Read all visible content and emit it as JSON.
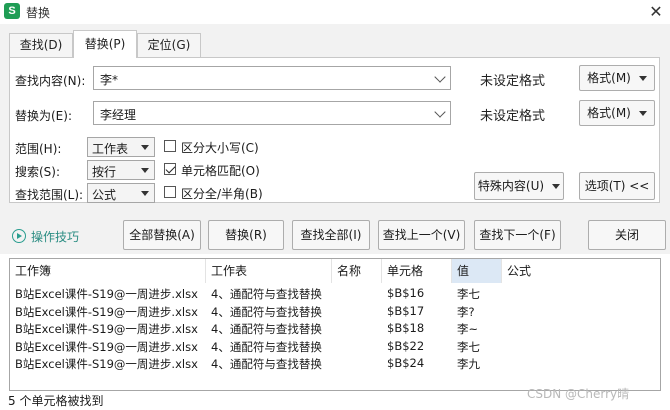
{
  "window": {
    "title": "替换",
    "app_icon_letter": "S"
  },
  "tabs": [
    {
      "label": "查找(D)"
    },
    {
      "label": "替换(P)"
    },
    {
      "label": "定位(G)"
    }
  ],
  "find": {
    "label": "查找内容(N):",
    "value": "李*",
    "format_status": "未设定格式",
    "format_button": "格式(M)"
  },
  "replace": {
    "label": "替换为(E):",
    "value": "李经理",
    "format_status": "未设定格式",
    "format_button": "格式(M)"
  },
  "options": {
    "scope": {
      "label": "范围(H):",
      "value": "工作表"
    },
    "search": {
      "label": "搜索(S):",
      "value": "按行"
    },
    "lookin": {
      "label": "查找范围(L):",
      "value": "公式"
    },
    "match_case": {
      "label": "区分大小写(C)",
      "checked": false
    },
    "match_cell": {
      "label": "单元格匹配(O)",
      "checked": true
    },
    "full_half": {
      "label": "区分全/半角(B)",
      "checked": false
    }
  },
  "special_button": "特殊内容(U)",
  "options_button": "选项(T) <<",
  "tips_link": "操作技巧",
  "actions": {
    "replace_all": "全部替换(A)",
    "replace": "替换(R)",
    "find_all": "查找全部(I)",
    "find_prev": "查找上一个(V)",
    "find_next": "查找下一个(F)",
    "close": "关闭"
  },
  "results": {
    "columns": [
      "工作簿",
      "工作表",
      "名称",
      "单元格",
      "值",
      "公式"
    ],
    "rows": [
      {
        "book": "B站Excel课件-S19@一周进步.xlsx",
        "sheet": "4、通配符与查找替换",
        "name": "",
        "cell": "$B$16",
        "value": "李七",
        "formula": ""
      },
      {
        "book": "B站Excel课件-S19@一周进步.xlsx",
        "sheet": "4、通配符与查找替换",
        "name": "",
        "cell": "$B$17",
        "value": "李?",
        "formula": ""
      },
      {
        "book": "B站Excel课件-S19@一周进步.xlsx",
        "sheet": "4、通配符与查找替换",
        "name": "",
        "cell": "$B$18",
        "value": "李~",
        "formula": ""
      },
      {
        "book": "B站Excel课件-S19@一周进步.xlsx",
        "sheet": "4、通配符与查找替换",
        "name": "",
        "cell": "$B$22",
        "value": "李七",
        "formula": ""
      },
      {
        "book": "B站Excel课件-S19@一周进步.xlsx",
        "sheet": "4、通配符与查找替换",
        "name": "",
        "cell": "$B$24",
        "value": "李九",
        "formula": ""
      }
    ]
  },
  "status": "5 个单元格被找到",
  "watermark": "CSDN @Cherry晴"
}
